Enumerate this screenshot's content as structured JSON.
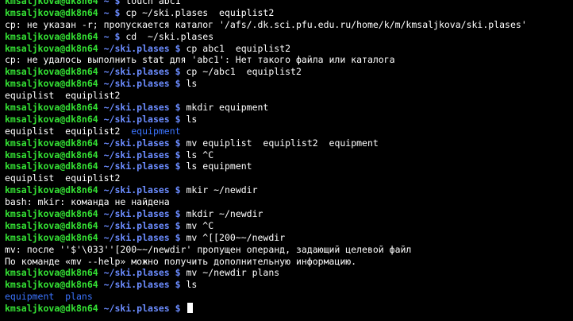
{
  "terminal": {
    "colors": {
      "background": "#000000",
      "user_host": "#34e234",
      "path_prompt": "#6b8cff",
      "directory_listing": "#3b74ff",
      "text": "#ffffff"
    },
    "lines": [
      {
        "kind": "prompt",
        "user": "kmsaljkova@dk8n64",
        "path": " ~",
        "symbol": " $",
        "command": " touch abc1"
      },
      {
        "kind": "prompt",
        "user": "kmsaljkova@dk8n64",
        "path": " ~",
        "symbol": " $",
        "command": " cp ~/ski.plases  equiplist2"
      },
      {
        "kind": "output",
        "text": "cp: не указан -r; пропускается каталог '/afs/.dk.sci.pfu.edu.ru/home/k/m/kmsaljkova/ski.plases'"
      },
      {
        "kind": "prompt",
        "user": "kmsaljkova@dk8n64",
        "path": " ~",
        "symbol": " $",
        "command": " cd  ~/ski.plases"
      },
      {
        "kind": "prompt",
        "user": "kmsaljkova@dk8n64",
        "path": " ~/ski.plases",
        "symbol": " $",
        "command": " cp abc1  equiplist2"
      },
      {
        "kind": "output",
        "text": "cp: не удалось выполнить stat для 'abc1': Нет такого файла или каталога"
      },
      {
        "kind": "prompt",
        "user": "kmsaljkova@dk8n64",
        "path": " ~/ski.plases",
        "symbol": " $",
        "command": " cp ~/abc1  equiplist2"
      },
      {
        "kind": "prompt",
        "user": "kmsaljkova@dk8n64",
        "path": " ~/ski.plases",
        "symbol": " $",
        "command": " ls"
      },
      {
        "kind": "output",
        "text": "equiplist  equiplist2"
      },
      {
        "kind": "prompt",
        "user": "kmsaljkova@dk8n64",
        "path": " ~/ski.plases",
        "symbol": " $",
        "command": " mkdir equipment"
      },
      {
        "kind": "prompt",
        "user": "kmsaljkova@dk8n64",
        "path": " ~/ski.plases",
        "symbol": " $",
        "command": " ls"
      },
      {
        "kind": "listing",
        "text": "equiplist  equiplist2  ",
        "dir": "equipment"
      },
      {
        "kind": "prompt",
        "user": "kmsaljkova@dk8n64",
        "path": " ~/ski.plases",
        "symbol": " $",
        "command": " mv equiplist  equiplist2  equipment"
      },
      {
        "kind": "prompt",
        "user": "kmsaljkova@dk8n64",
        "path": " ~/ski.plases",
        "symbol": " $",
        "command": " ls ^C"
      },
      {
        "kind": "prompt",
        "user": "kmsaljkova@dk8n64",
        "path": " ~/ski.plases",
        "symbol": " $",
        "command": " ls equipment"
      },
      {
        "kind": "output",
        "text": "equiplist  equiplist2"
      },
      {
        "kind": "prompt",
        "user": "kmsaljkova@dk8n64",
        "path": " ~/ski.plases",
        "symbol": " $",
        "command": " mkir ~/newdir"
      },
      {
        "kind": "output",
        "text": "bash: mkir: команда не найдена"
      },
      {
        "kind": "prompt",
        "user": "kmsaljkova@dk8n64",
        "path": " ~/ski.plases",
        "symbol": " $",
        "command": " mkdir ~/newdir"
      },
      {
        "kind": "prompt",
        "user": "kmsaljkova@dk8n64",
        "path": " ~/ski.plases",
        "symbol": " $",
        "command": " mv ^C"
      },
      {
        "kind": "prompt",
        "user": "kmsaljkova@dk8n64",
        "path": " ~/ski.plases",
        "symbol": " $",
        "command": " mv ^[[200~~/newdir"
      },
      {
        "kind": "output",
        "text": "mv: после ''$'\\033''[200~~/newdir' пропущен операнд, задающий целевой файл"
      },
      {
        "kind": "output",
        "text": "По команде «mv --help» можно получить дополнительную информацию."
      },
      {
        "kind": "prompt",
        "user": "kmsaljkova@dk8n64",
        "path": " ~/ski.plases",
        "symbol": " $",
        "command": " mv ~/newdir plans"
      },
      {
        "kind": "prompt",
        "user": "kmsaljkova@dk8n64",
        "path": " ~/ski.plases",
        "symbol": " $",
        "command": " ls"
      },
      {
        "kind": "dirlisting",
        "text": "equipment  plans"
      },
      {
        "kind": "prompt",
        "user": "kmsaljkova@dk8n64",
        "path": " ~/ski.plases",
        "symbol": " $",
        "command": " ",
        "cursor": true
      }
    ]
  }
}
